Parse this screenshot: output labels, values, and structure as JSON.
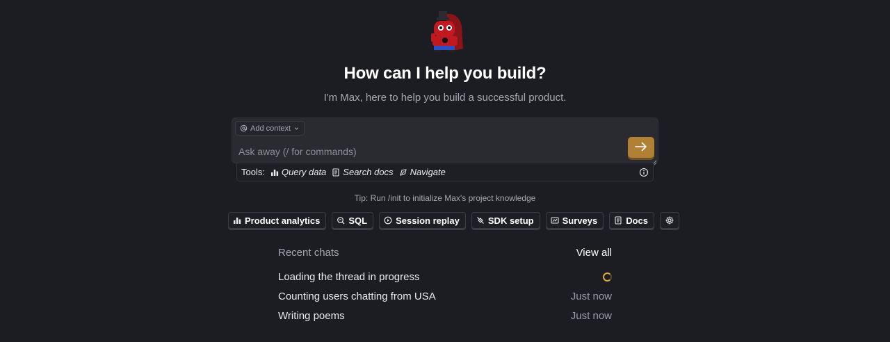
{
  "hero": {
    "headline": "How can I help you build?",
    "subline": "I'm Max, here to help you build a successful product."
  },
  "composer": {
    "context_label": "Add context",
    "placeholder": "Ask away (/ for commands)",
    "value": ""
  },
  "tools": {
    "label": "Tools:",
    "items": [
      {
        "label": "Query data",
        "icon": "bar-chart-icon"
      },
      {
        "label": "Search docs",
        "icon": "document-icon"
      },
      {
        "label": "Navigate",
        "icon": "compass-icon"
      }
    ]
  },
  "tip": "Tip: Run /init to initialize Max's project knowledge",
  "suggestions": [
    {
      "label": "Product analytics",
      "icon": "bar-chart-icon"
    },
    {
      "label": "SQL",
      "icon": "sql-icon"
    },
    {
      "label": "Session replay",
      "icon": "replay-icon"
    },
    {
      "label": "SDK setup",
      "icon": "plug-icon"
    },
    {
      "label": "Surveys",
      "icon": "survey-icon"
    },
    {
      "label": "Docs",
      "icon": "document-icon"
    }
  ],
  "recent": {
    "title": "Recent chats",
    "view_all": "View all",
    "chats": [
      {
        "title": "Loading the thread in progress",
        "time": "",
        "loading": true
      },
      {
        "title": "Counting users chatting from USA",
        "time": "Just now"
      },
      {
        "title": "Writing poems",
        "time": "Just now"
      }
    ]
  },
  "colors": {
    "background": "#1c1d22",
    "accent": "#b08035",
    "spinner": "#e0a63a"
  }
}
